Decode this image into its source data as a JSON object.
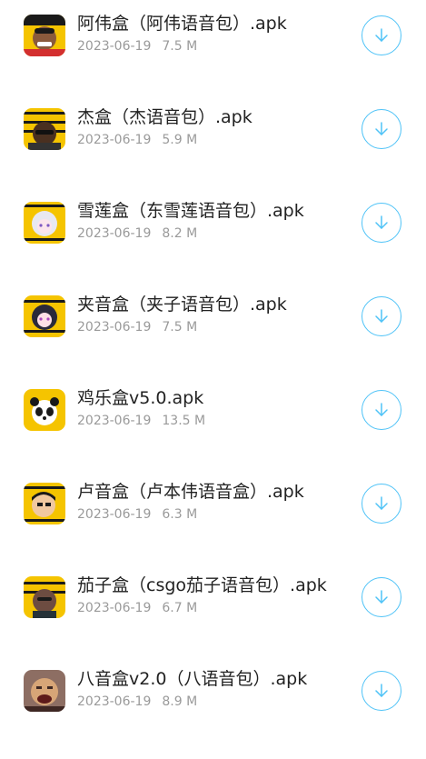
{
  "accent_color": "#4fc3f7",
  "files": [
    {
      "name": "阿伟盒（阿伟语音包）.apk",
      "date": "2023-06-19",
      "size": "7.5 M",
      "icon": "awei-avatar-icon",
      "download_icon": "download-icon"
    },
    {
      "name": "杰盒（杰语音包）.apk",
      "date": "2023-06-19",
      "size": "5.9 M",
      "icon": "jie-avatar-icon",
      "download_icon": "download-icon"
    },
    {
      "name": "雪莲盒（东雪莲语音包）.apk",
      "date": "2023-06-19",
      "size": "8.2 M",
      "icon": "xuelian-avatar-icon",
      "download_icon": "download-icon"
    },
    {
      "name": "夹音盒（夹子语音包）.apk",
      "date": "2023-06-19",
      "size": "7.5 M",
      "icon": "jiazi-avatar-icon",
      "download_icon": "download-icon"
    },
    {
      "name": "鸡乐盒v5.0.apk",
      "date": "2023-06-19",
      "size": "13.5 M",
      "icon": "panda-avatar-icon",
      "download_icon": "download-icon"
    },
    {
      "name": "卢音盒（卢本伟语音盒）.apk",
      "date": "2023-06-19",
      "size": "6.3 M",
      "icon": "lubenwei-avatar-icon",
      "download_icon": "download-icon"
    },
    {
      "name": "茄子盒（csgo茄子语音包）.apk",
      "date": "2023-06-19",
      "size": "6.7 M",
      "icon": "qiezi-avatar-icon",
      "download_icon": "download-icon"
    },
    {
      "name": "八音盒v2.0（八语音包）.apk",
      "date": "2023-06-19",
      "size": "8.9 M",
      "icon": "bayin-avatar-icon",
      "download_icon": "download-icon"
    }
  ]
}
